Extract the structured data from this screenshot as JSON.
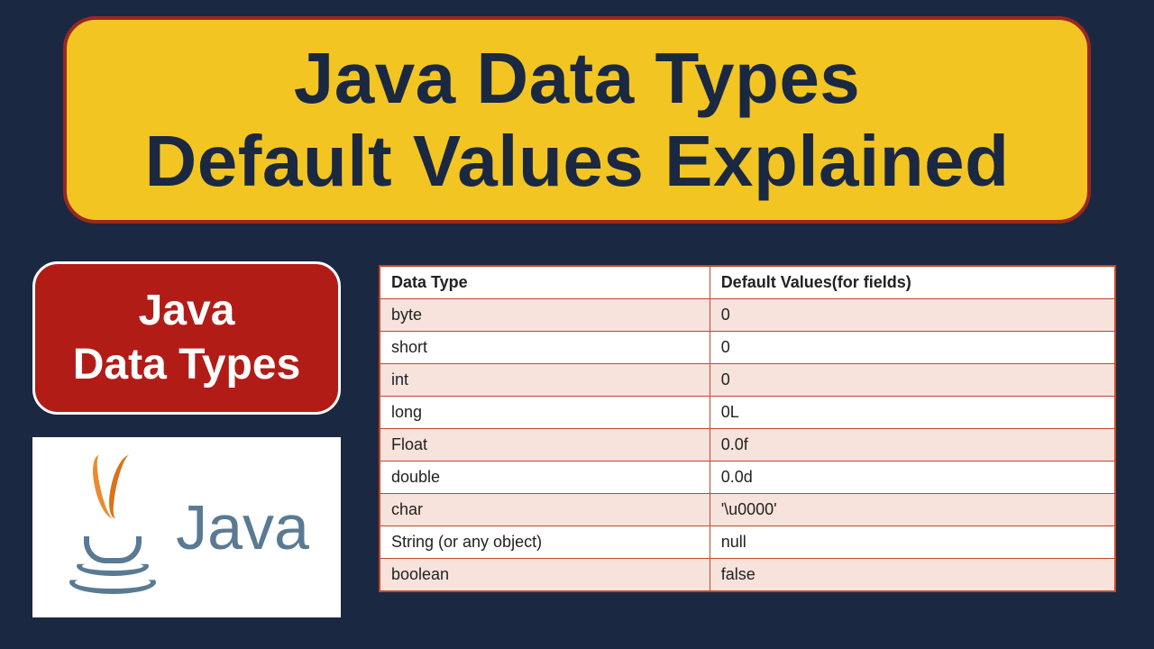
{
  "title": {
    "line1": "Java Data Types",
    "line2": "Default Values Explained"
  },
  "subtitle": {
    "line1": "Java",
    "line2": "Data Types"
  },
  "logo": {
    "text": "Java"
  },
  "table": {
    "headers": [
      "Data Type",
      "Default Values(for fields)"
    ],
    "rows": [
      [
        "byte",
        "0"
      ],
      [
        "short",
        "0"
      ],
      [
        "int",
        "0"
      ],
      [
        "long",
        "0L"
      ],
      [
        "Float",
        "0.0f"
      ],
      [
        "double",
        "0.0d"
      ],
      [
        "char",
        "'\\u0000'"
      ],
      [
        "String (or any object)",
        "null"
      ],
      [
        "boolean",
        "false"
      ]
    ]
  },
  "chart_data": {
    "type": "table",
    "title": "Java Data Types Default Values",
    "columns": [
      "Data Type",
      "Default Values(for fields)"
    ],
    "rows": [
      {
        "data_type": "byte",
        "default_value": "0"
      },
      {
        "data_type": "short",
        "default_value": "0"
      },
      {
        "data_type": "int",
        "default_value": "0"
      },
      {
        "data_type": "long",
        "default_value": "0L"
      },
      {
        "data_type": "Float",
        "default_value": "0.0f"
      },
      {
        "data_type": "double",
        "default_value": "0.0d"
      },
      {
        "data_type": "char",
        "default_value": "'\\u0000'"
      },
      {
        "data_type": "String (or any object)",
        "default_value": "null"
      },
      {
        "data_type": "boolean",
        "default_value": "false"
      }
    ]
  }
}
